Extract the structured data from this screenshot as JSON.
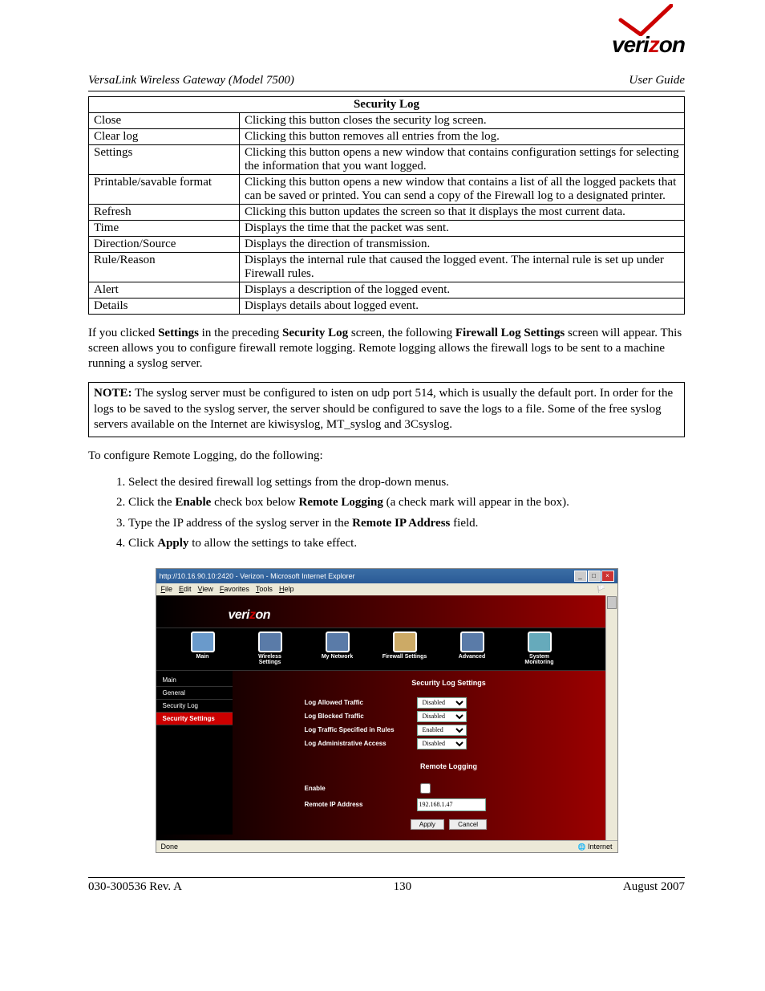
{
  "brand": "verizon",
  "header": {
    "left": "VersaLink Wireless Gateway (Model 7500)",
    "right": "User Guide"
  },
  "table": {
    "title": "Security Log",
    "rows": [
      {
        "name": "Close",
        "desc": "Clicking this button closes the security log screen."
      },
      {
        "name": "Clear log",
        "desc": "Clicking this button removes all entries from the log."
      },
      {
        "name": "Settings",
        "desc": "Clicking this button opens a new window that contains configuration settings for selecting the information that you want logged."
      },
      {
        "name": "Printable/savable format",
        "desc": "Clicking this button opens a new window that contains a list of all the logged packets that can be saved or printed. You can send a copy of the Firewall log to a designated printer."
      },
      {
        "name": "Refresh",
        "desc": "Clicking this button updates the screen so that it displays the most current data."
      },
      {
        "name": "Time",
        "desc": "Displays the time that the packet was sent."
      },
      {
        "name": "Direction/Source",
        "desc": "Displays the direction of transmission."
      },
      {
        "name": "Rule/Reason",
        "desc": "Displays the internal rule that caused the logged event. The internal rule is set up under Firewall rules."
      },
      {
        "name": "Alert",
        "desc": "Displays a description of the logged event."
      },
      {
        "name": "Details",
        "desc": "Displays details about logged event."
      }
    ]
  },
  "para1": {
    "pre": "If you clicked ",
    "b1": "Settings",
    "mid1": " in the preceding ",
    "b2": "Security Log",
    "mid2": " screen, the following ",
    "b3": "Firewall Log Settings",
    "post": " screen will appear. This screen allows you to configure firewall remote logging. Remote logging allows the firewall logs to be sent to a machine running a syslog server."
  },
  "note": {
    "label": "NOTE:",
    "text": " The syslog server must be configured to isten on udp port 514, which is usually the default port. In order for the logs to be saved to the syslog server, the server should be configured to save the logs to a file. Some of the free syslog servers available on the Internet are kiwisyslog, MT_syslog and 3Csyslog."
  },
  "para2": "To configure Remote Logging, do the following:",
  "steps": [
    {
      "text": "Select the desired firewall log settings from the drop-down menus."
    },
    {
      "pre": "Click the ",
      "b1": "Enable",
      "mid": " check box below ",
      "b2": "Remote Logging",
      "post": " (a check mark will appear in the box)."
    },
    {
      "pre": "Type the IP address of the syslog server in the ",
      "b1": "Remote IP Address",
      "post": " field."
    },
    {
      "pre": "Click ",
      "b1": "Apply",
      "post": " to allow the settings to take effect."
    }
  ],
  "screenshot": {
    "title": "http://10.16.90.10:2420 - Verizon - Microsoft Internet Explorer",
    "menu": [
      "File",
      "Edit",
      "View",
      "Favorites",
      "Tools",
      "Help"
    ],
    "nav": [
      "Main",
      "Wireless Settings",
      "My Network",
      "Firewall Settings",
      "Advanced",
      "System Monitoring"
    ],
    "sidebar": [
      "Main",
      "General",
      "Security Log",
      "Security Settings"
    ],
    "sidebar_active": 3,
    "content_title": "Security Log Settings",
    "settings": [
      {
        "label": "Log Allowed Traffic",
        "value": "Disabled"
      },
      {
        "label": "Log Blocked Traffic",
        "value": "Disabled"
      },
      {
        "label": "Log Traffic Specified in Rules",
        "value": "Enabled"
      },
      {
        "label": "Log Administrative Access",
        "value": "Disabled"
      }
    ],
    "section2_title": "Remote Logging",
    "enable_label": "Enable",
    "ip_label": "Remote IP Address",
    "ip_value": "192.168.1.47",
    "apply": "Apply",
    "cancel": "Cancel",
    "status_left": "Done",
    "status_right": "Internet"
  },
  "footer": {
    "left": "030-300536 Rev. A",
    "center": "130",
    "right": "August 2007"
  }
}
